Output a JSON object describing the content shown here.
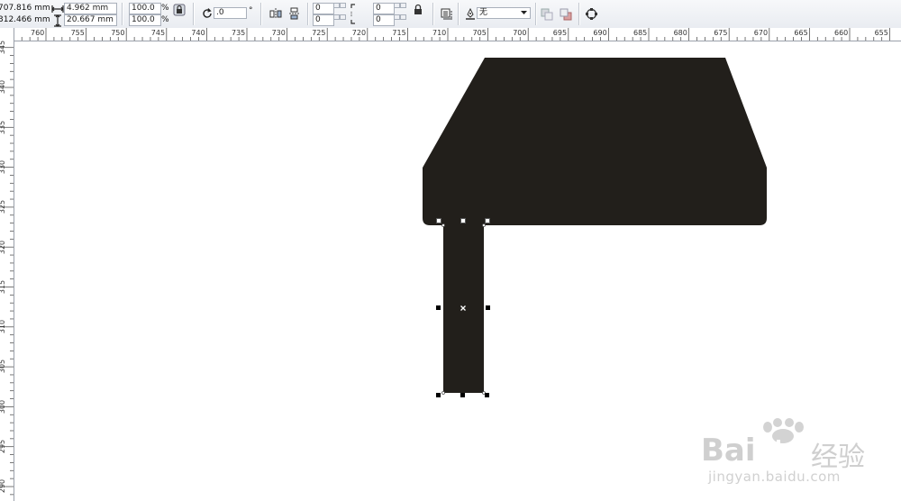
{
  "toolbar": {
    "pos_x": "707.816 mm",
    "pos_y": "312.466 mm",
    "width": "4.962 mm",
    "height": "20.667 mm",
    "scale_x": "100.0",
    "scale_y": "100.0",
    "percent": "%",
    "rotation": ".0",
    "degree": "°",
    "corner_tl": "0",
    "corner_bl": "0",
    "corner_tr": "0",
    "corner_br": "0",
    "outline_width": "无"
  },
  "ruler": {
    "h_labels": [
      "760",
      "755",
      "750",
      "745",
      "740",
      "735",
      "730",
      "725",
      "720",
      "715",
      "710",
      "705",
      "700",
      "695",
      "690",
      "685",
      "680",
      "675",
      "670",
      "665",
      "660",
      "655"
    ],
    "v_labels": [
      "345",
      "340",
      "335",
      "330",
      "325",
      "320",
      "315",
      "310",
      "305",
      "300",
      "295",
      "290"
    ]
  },
  "watermark": {
    "brand": "Bai",
    "brand2": "du",
    "cn": "经验",
    "url": "jingyan.baidu.com"
  },
  "colors": {
    "shape_fill": "#221f1b",
    "toolbar_bg": "#eceff3"
  }
}
